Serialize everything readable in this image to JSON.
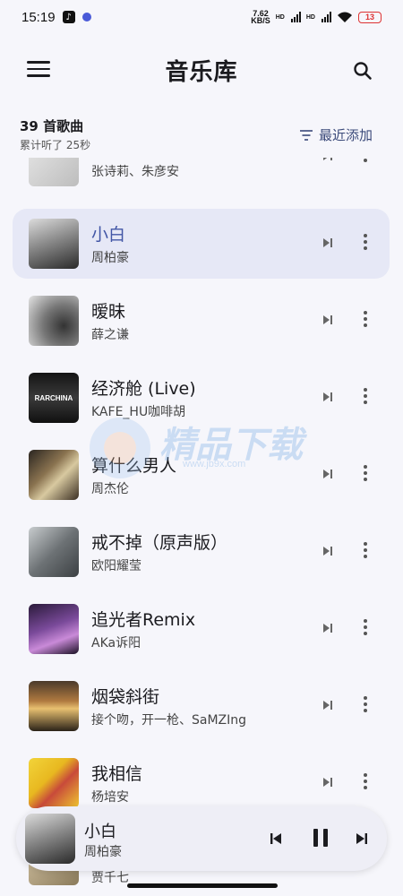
{
  "status": {
    "time": "15:19",
    "speed_top": "7.62",
    "speed_bottom": "KB/S",
    "hd1": "HD",
    "hd2": "HD",
    "battery": "13"
  },
  "header": {
    "title": "音乐库"
  },
  "summary": {
    "count": "39 首歌曲",
    "listened": "累计听了 25秒",
    "sort_label": "最近添加"
  },
  "songs": [
    {
      "title": "",
      "artist": "张诗莉、朱彦安"
    },
    {
      "title": "小白",
      "artist": "周柏豪"
    },
    {
      "title": "暧昧",
      "artist": "薛之谦"
    },
    {
      "title": "经济舱 (Live)",
      "artist": "KAFE_HU咖啡胡"
    },
    {
      "title": "算什么男人",
      "artist": "周杰伦"
    },
    {
      "title": "戒不掉（原声版）",
      "artist": "欧阳耀莹"
    },
    {
      "title": "追光者Remix",
      "artist": "AKa诉阳"
    },
    {
      "title": "烟袋斜街",
      "artist": "接个吻，开一枪、SaMZIng"
    },
    {
      "title": "我相信",
      "artist": "杨培安"
    },
    {
      "title": "",
      "artist": "贾千七"
    }
  ],
  "cover_texts": {
    "jingjicang": "RARCHINA"
  },
  "watermark": {
    "text": "精品下载",
    "url": "www.jb9x.com"
  },
  "now_playing": {
    "title": "小白",
    "artist": "周柏豪"
  },
  "colors": {
    "accent": "#4256a6",
    "active_row": "#e6e8f6",
    "background": "#f6f6fb"
  }
}
